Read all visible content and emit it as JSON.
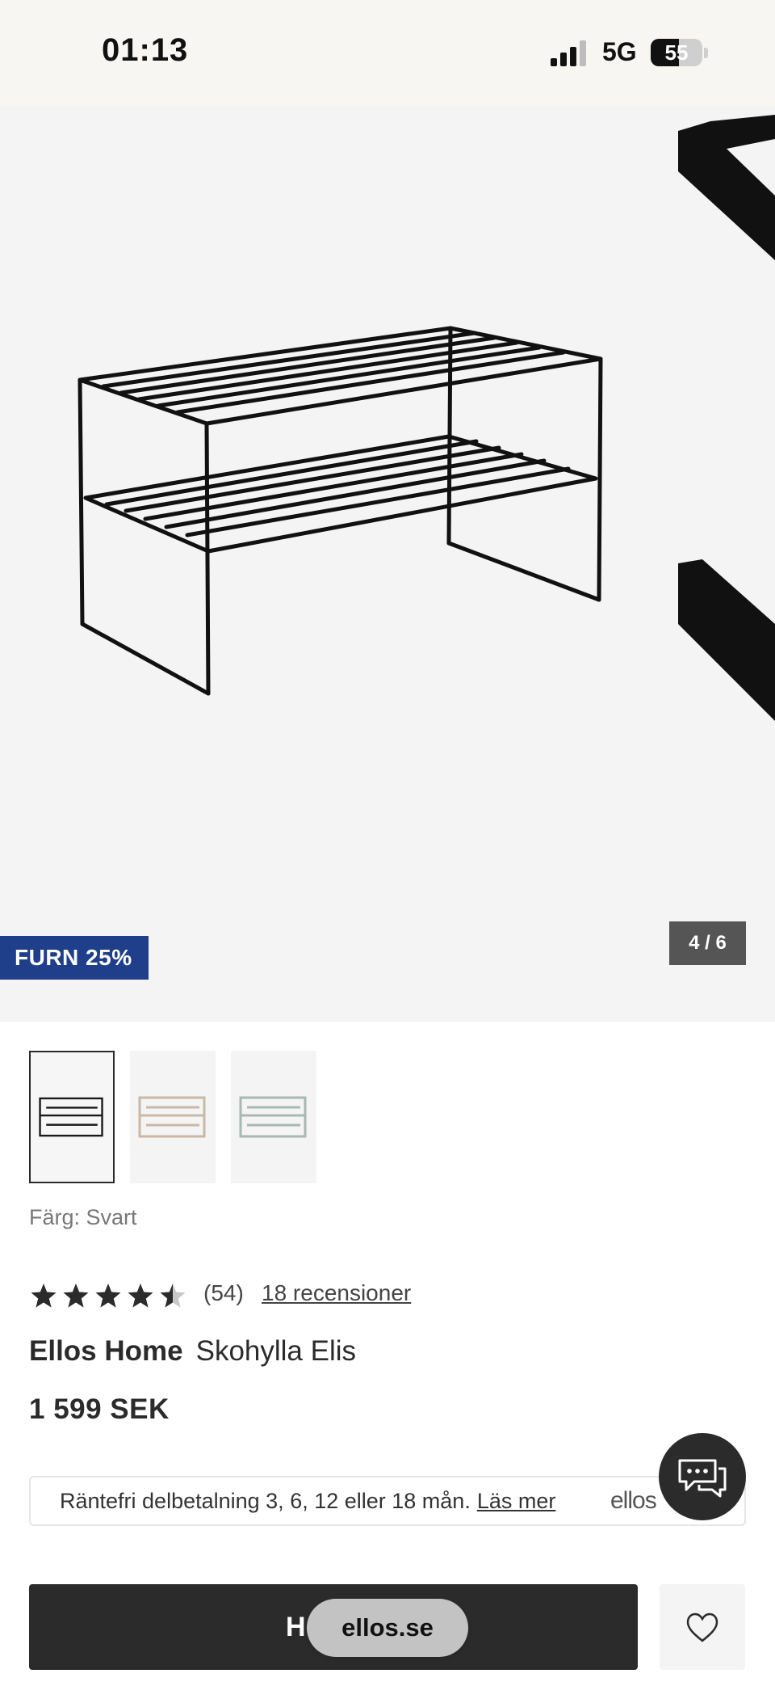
{
  "status_bar": {
    "time": "01:13",
    "network": "5G",
    "battery": "55",
    "battery_level": 0.55
  },
  "gallery": {
    "promo_badge": "FURN 25%",
    "counter": "4 / 6"
  },
  "color_options": [
    {
      "name": "Svart",
      "selected": true,
      "color": "#1a1a1a"
    },
    {
      "name": "Beige",
      "selected": false,
      "color": "#c9b8a6"
    },
    {
      "name": "Grön",
      "selected": false,
      "color": "#a9b8b0"
    }
  ],
  "color_label": "Färg: Svart",
  "rating": {
    "stars": 4.5,
    "count": "(54)",
    "reviews_link": "18 recensioner"
  },
  "product": {
    "brand": "Ellos Home",
    "name": "Skohylla Elis",
    "price": "1 599 SEK"
  },
  "finance": {
    "text": "Räntefri delbetalning 3, 6, 12 eller 18 mån.",
    "link": "Läs mer",
    "logo": "ellos"
  },
  "actions": {
    "add_to_cart_label": "H",
    "url": "ellos.se"
  },
  "colors": {
    "promo": "#1f3f8a",
    "dark": "#2b2b2b"
  },
  "icons": [
    "signal-icon",
    "battery-icon",
    "chat-icon",
    "heart-icon",
    "star-icon"
  ]
}
